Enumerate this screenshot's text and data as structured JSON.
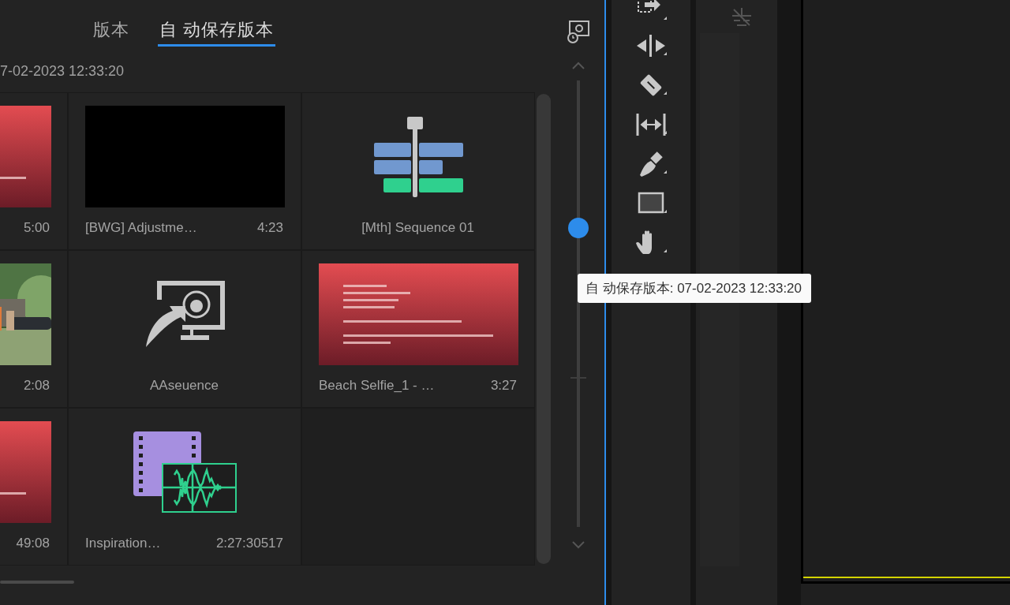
{
  "tabs": [
    {
      "label": "版本",
      "selected": false
    },
    {
      "label": "自 动保存版本",
      "selected": true
    }
  ],
  "date": "7-02-2023 12:33:20",
  "grid": [
    [
      {
        "kind": "offline",
        "duration": "5:00"
      },
      {
        "kind": "black",
        "name": "[BWG] Adjustme…",
        "duration": "4:23"
      },
      {
        "kind": "sequence",
        "name": "[Mth] Sequence 01"
      }
    ],
    [
      {
        "duration": "2:08"
      },
      {
        "kind": "multicam",
        "name": "AAseuence"
      },
      {
        "kind": "offline",
        "name": "Beach Selfie_1 - …",
        "duration": "3:27"
      }
    ],
    [
      {
        "kind": "offline",
        "duration": "49:08"
      },
      {
        "kind": "av_clip",
        "name": "Inspiration…",
        "duration": "2:27:30517"
      },
      {
        "kind": "empty"
      }
    ]
  ],
  "slider": {
    "level": 0.67
  },
  "tooltip": {
    "text": "自 动保存版本: 07-02-2023 12:33:20"
  }
}
